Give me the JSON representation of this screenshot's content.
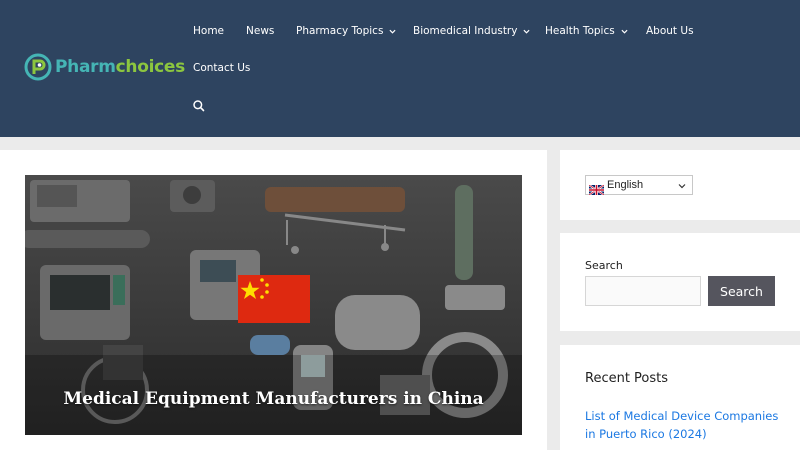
{
  "brand": {
    "name_part1": "Pharm",
    "name_part2": "choices"
  },
  "nav": {
    "items": [
      {
        "label": "Home",
        "has_dropdown": false
      },
      {
        "label": "News",
        "has_dropdown": false
      },
      {
        "label": "Pharmacy Topics",
        "has_dropdown": true
      },
      {
        "label": "Biomedical Industry",
        "has_dropdown": true
      },
      {
        "label": "Health Topics",
        "has_dropdown": true
      },
      {
        "label": "About Us",
        "has_dropdown": false
      },
      {
        "label": "Contact Us",
        "has_dropdown": false
      }
    ],
    "search_icon": "search-icon"
  },
  "hero": {
    "caption": "Medical Equipment Manufacturers in China"
  },
  "sidebar": {
    "language": {
      "selected": "English",
      "icon": "uk-flag-icon"
    },
    "search": {
      "label": "Search",
      "placeholder": "",
      "button_label": "Search"
    },
    "recent_posts": {
      "title": "Recent Posts",
      "items": [
        "List of Medical Device Companies in Puerto Rico (2024)"
      ]
    }
  },
  "colors": {
    "header_bg": "#2e4460",
    "page_bg": "#ebebeb",
    "link": "#1b78e2",
    "button_bg": "#55555e",
    "logo_teal": "#45b5b5",
    "logo_green": "#8cc63f"
  }
}
